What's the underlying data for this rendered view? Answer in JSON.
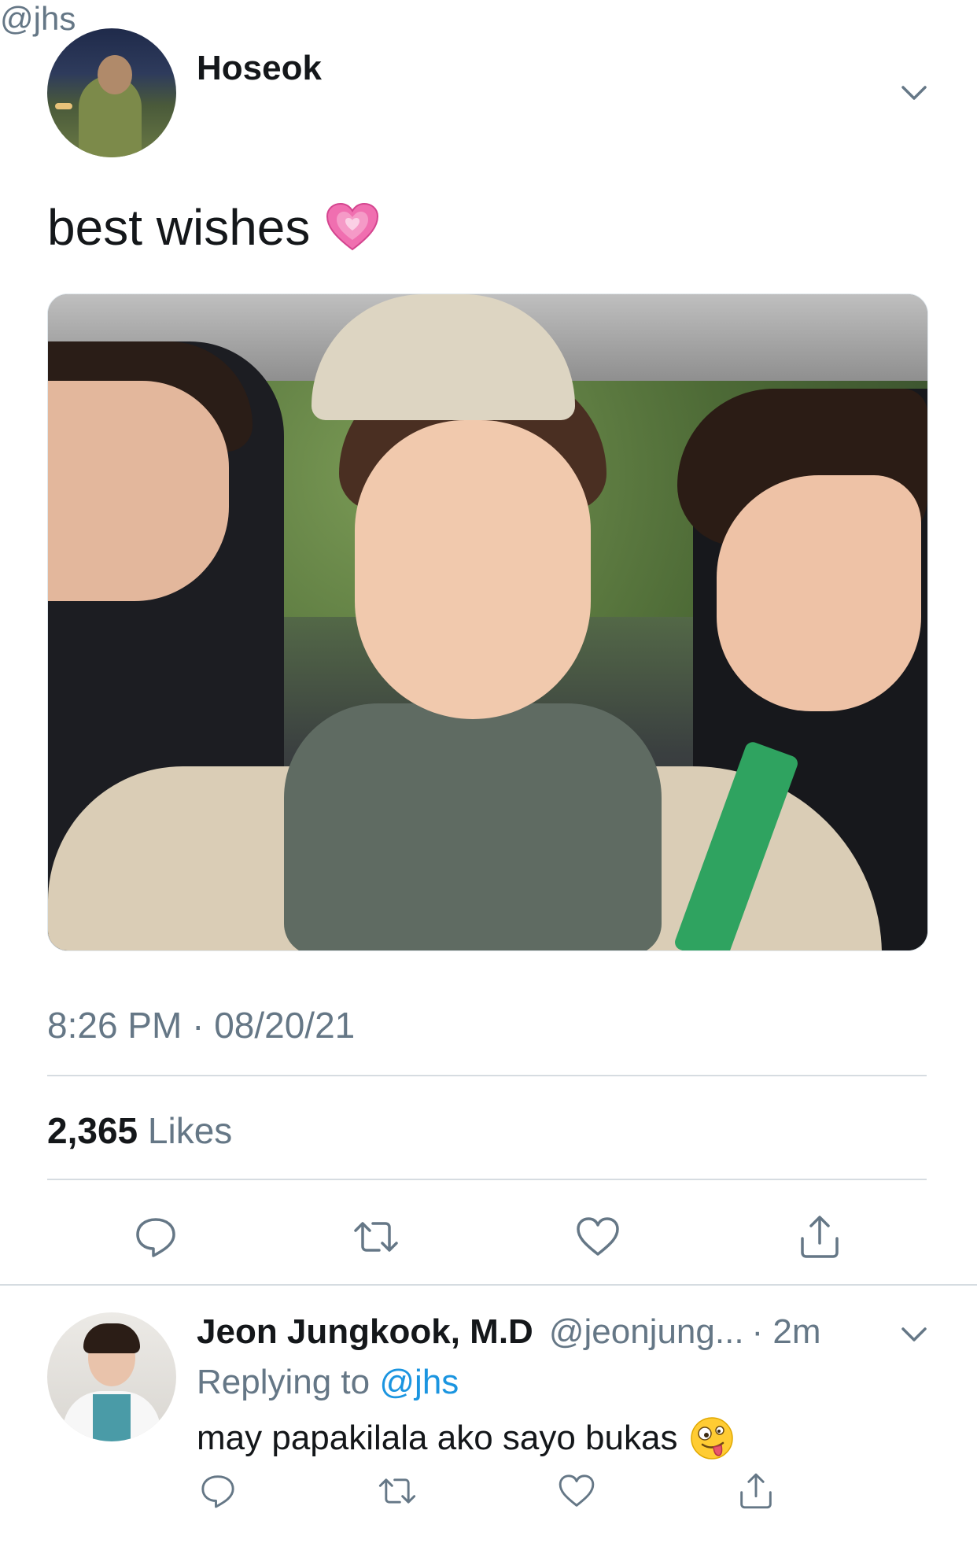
{
  "tweet": {
    "author_name": "Hoseok",
    "author_handle": "@jhs",
    "text": "best wishes",
    "emoji_name": "growing-heart",
    "time": "8:26 PM · 08/20/21",
    "likes_count": "2,365",
    "likes_label": "Likes",
    "actions": [
      "reply-icon",
      "retweet-icon",
      "like-icon",
      "share-icon"
    ]
  },
  "reply": {
    "author_name": "Jeon Jungkook, M.D",
    "author_handle": "@jeonjung...",
    "time": "· 2m",
    "replying_prefix": "Replying to",
    "replying_to": "@jhs",
    "text": "may papakilala ako sayo bukas",
    "emoji_name": "zany-face",
    "actions": [
      "reply-icon",
      "retweet-icon",
      "like-icon",
      "share-icon"
    ]
  },
  "colors": {
    "text_primary": "#14171a",
    "text_secondary": "#657786",
    "link": "#1b95e0",
    "divider": "#d6dce1",
    "icon": "#657786"
  }
}
